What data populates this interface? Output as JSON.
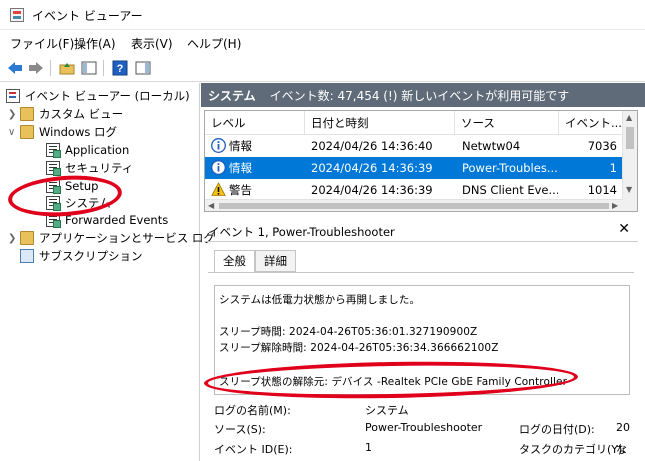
{
  "window": {
    "title": "イベント ビューアー"
  },
  "menu": [
    {
      "label": "ファイル(F)"
    },
    {
      "label": "操作(A)"
    },
    {
      "label": "表示(V)"
    },
    {
      "label": "ヘルプ(H)"
    }
  ],
  "tree": {
    "root": "イベント ビューアー (ローカル)",
    "custom_views": "カスタム ビュー",
    "windows_logs": "Windows ログ",
    "application": "Application",
    "security": "セキュリティ",
    "setup": "Setup",
    "system": "システム",
    "forwarded": "Forwarded Events",
    "app_services": "アプリケーションとサービス ログ",
    "subscriptions": "サブスクリプション"
  },
  "header": {
    "title": "システム",
    "summary": "イベント数: 47,454 (!) 新しいイベントが利用可能です"
  },
  "list": {
    "columns": [
      "レベル",
      "日付と時刻",
      "ソース",
      "イベント..."
    ],
    "rows": [
      {
        "level": "情報",
        "datetime": "2024/04/26 14:36:40",
        "source": "Netwtw04",
        "id": "7036",
        "icon": "info-icon"
      },
      {
        "level": "情報",
        "datetime": "2024/04/26 14:36:39",
        "source": "Power-Troubles...",
        "id": "1",
        "icon": "info-icon"
      },
      {
        "level": "警告",
        "datetime": "2024/04/26 14:36:39",
        "source": "DNS Client Eve...",
        "id": "1014",
        "icon": "warning-icon"
      }
    ]
  },
  "detail": {
    "title": "イベント 1, Power-Troubleshooter",
    "tabs": [
      "全般",
      "詳細"
    ],
    "message": [
      "システムは低電力状態から再開しました。",
      "スリープ時間: 2024-04-26T05:36:01.327190900Z",
      "スリープ解除時間: 2024-04-26T05:36:34.366662100Z",
      "スリープ状態の解除元: デバイス -Realtek PCIe GbE Family Controller"
    ],
    "props": {
      "log_name_label": "ログの名前(M):",
      "log_name_value": "システム",
      "source_label": "ソース(S):",
      "source_value": "Power-Troubleshooter",
      "logged_label": "ログの日付(D):",
      "logged_value": "20",
      "event_id_label": "イベント ID(E):",
      "event_id_value": "1",
      "task_label": "タスクのカテゴリ(Y):",
      "task_value": "な"
    }
  },
  "colors": {
    "selection": "#0078d7",
    "header_bg": "#5f6b78",
    "annotation": "#e0001b"
  }
}
